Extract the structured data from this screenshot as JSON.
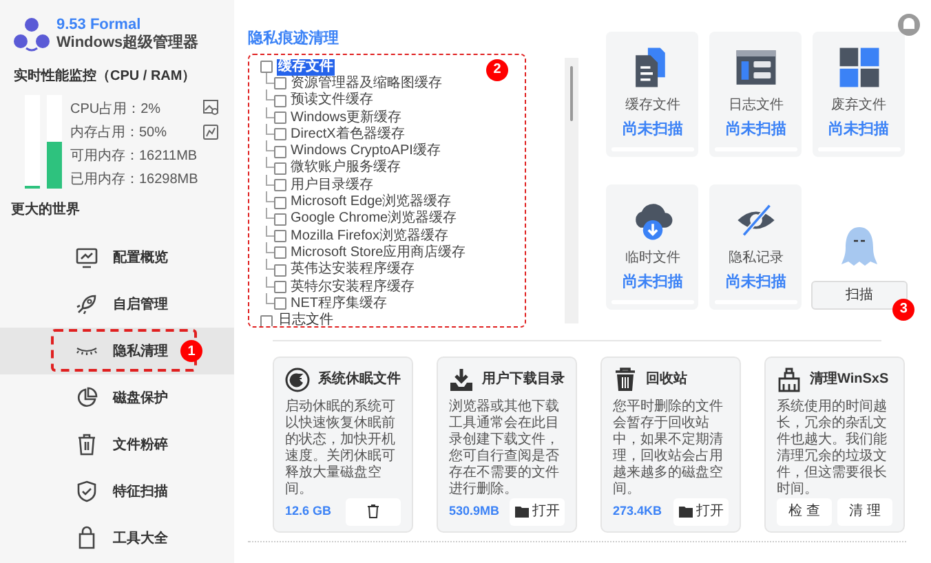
{
  "app": {
    "version": "9.53 Formal",
    "name": "Windows超级管理器"
  },
  "monitor": {
    "title": "实时性能监控（CPU / RAM）",
    "bars": [
      {
        "level": 0.02
      },
      {
        "level": 0.5
      }
    ],
    "stats": [
      {
        "label": "CPU占用：",
        "value": "2%"
      },
      {
        "label": "内存占用：",
        "value": "50%"
      },
      {
        "label": "可用内存：",
        "value": "16211MB"
      },
      {
        "label": "已用内存：",
        "value": "16298MB"
      }
    ]
  },
  "sidebar": {
    "heading": "更大的世界",
    "items": [
      {
        "label": "配置概览",
        "selected": false
      },
      {
        "label": "自启管理",
        "selected": false
      },
      {
        "label": "隐私清理",
        "selected": true
      },
      {
        "label": "磁盘保护",
        "selected": false
      },
      {
        "label": "文件粉碎",
        "selected": false
      },
      {
        "label": "特征扫描",
        "selected": false
      },
      {
        "label": "工具大全",
        "selected": false
      }
    ]
  },
  "section_title": "隐私痕迹清理",
  "tree": [
    {
      "label": "缓存文件",
      "checked": false,
      "selected": true,
      "children": [
        {
          "label": "资源管理器及缩略图缓存",
          "checked": false
        },
        {
          "label": "预读文件缓存",
          "checked": false
        },
        {
          "label": "Windows更新缓存",
          "checked": false
        },
        {
          "label": "DirectX着色器缓存",
          "checked": false
        },
        {
          "label": "Windows CryptoAPI缓存",
          "checked": false
        },
        {
          "label": "微软账户服务缓存",
          "checked": false
        },
        {
          "label": "用户目录缓存",
          "checked": false
        },
        {
          "label": "Microsoft Edge浏览器缓存",
          "checked": false
        },
        {
          "label": "Google Chrome浏览器缓存",
          "checked": false
        },
        {
          "label": "Mozilla Firefox浏览器缓存",
          "checked": false
        },
        {
          "label": "Microsoft Store应用商店缓存",
          "checked": false
        },
        {
          "label": "英伟达安装程序缓存",
          "checked": false
        },
        {
          "label": "英特尔安装程序缓存",
          "checked": false
        },
        {
          "label": "NET程序集缓存",
          "checked": false
        }
      ]
    },
    {
      "label": "日志文件",
      "checked": false,
      "selected": false
    }
  ],
  "scan_tiles": [
    {
      "kind": "cache",
      "label": "缓存文件",
      "status": "尚未扫描"
    },
    {
      "kind": "log",
      "label": "日志文件",
      "status": "尚未扫描"
    },
    {
      "kind": "waste",
      "label": "废弃文件",
      "status": "尚未扫描"
    },
    {
      "kind": "temp",
      "label": "临时文件",
      "status": "尚未扫描"
    },
    {
      "kind": "privacy",
      "label": "隐私记录",
      "status": "尚未扫描"
    }
  ],
  "scan_button": "扫描",
  "tools": [
    {
      "title": "系统休眠文件",
      "text": "启动休眠的系统可以快速恢复休眠前的状态，加快开机速度。关闭休眠可释放大量磁盘空间。",
      "size": "12.6 GB",
      "buttons": [
        {
          "kind": "delete"
        }
      ]
    },
    {
      "title": "用户下载目录",
      "text": "浏览器或其他下载工具通常会在此目录创建下载文件，您可自行查阅是否存在不需要的文件进行删除。",
      "size": "530.9MB",
      "buttons": [
        {
          "kind": "open",
          "label": "打开"
        }
      ]
    },
    {
      "title": "回收站",
      "text": "您平时删除的文件会暂存于回收站中，如果不定期清理，回收站会占用越来越多的磁盘空间。",
      "size": "273.4KB",
      "buttons": [
        {
          "kind": "open",
          "label": "打开"
        }
      ]
    },
    {
      "title": "清理WinSxS",
      "text": "系统使用的时间越长，冗余的杂乱文件也越大。我们能清理冗余的垃圾文件，但这需要很长时间。",
      "buttons": [
        {
          "kind": "text",
          "label": "检 查"
        },
        {
          "kind": "text",
          "label": "清 理"
        }
      ]
    }
  ],
  "callouts": [
    "1",
    "2",
    "3"
  ]
}
